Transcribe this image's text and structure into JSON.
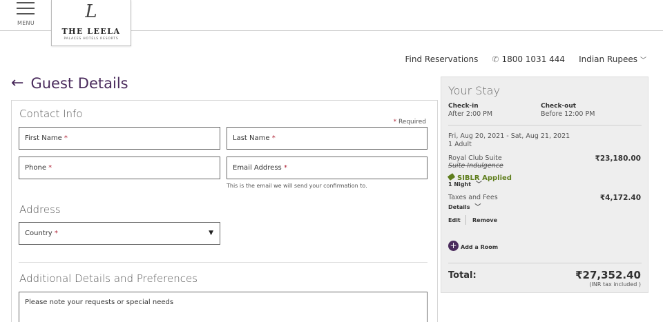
{
  "header": {
    "menu_label": "MENU",
    "logo_glyph": "L",
    "logo_name": "THE LEELA",
    "logo_sub": "PALACES HOTELS RESORTS",
    "find_reservations": "Find Reservations",
    "phone": "1800 1031 444",
    "currency": "Indian Rupees"
  },
  "page": {
    "title": "Guest Details"
  },
  "form": {
    "contact_title": "Contact Info",
    "required_note": "Required",
    "first_name_label": "First Name",
    "last_name_label": "Last Name",
    "phone_label": "Phone",
    "email_label": "Email Address",
    "email_hint": "This is the email we will send your confirmation to.",
    "address_title": "Address",
    "country_label": "Country",
    "additional_title": "Additional Details and Preferences",
    "requests_placeholder": "Please note your requests or special needs"
  },
  "stay": {
    "title": "Your Stay",
    "checkin_label": "Check-in",
    "checkin_value": "After 2:00 PM",
    "checkout_label": "Check-out",
    "checkout_value": "Before 12:00 PM",
    "dates": "Fri, Aug 20, 2021 - Sat, Aug 21, 2021",
    "guests": "1 Adult",
    "room_name": "Royal Club Suite",
    "rate_name": "Suite Indulgence",
    "promo": "SIBLR Applied",
    "nights": "1 Night",
    "room_price": "₹23,180.00",
    "taxes_label": "Taxes and Fees",
    "taxes_details": "Details",
    "taxes_price": "₹4,172.40",
    "edit_label": "Edit",
    "remove_label": "Remove",
    "add_room_label": "Add a Room",
    "total_label": "Total:",
    "total_value": "₹27,352.40",
    "total_note": "(INR tax included )"
  },
  "colors": {
    "brand_purple": "#4a2b5c",
    "required_red": "#b0283a",
    "promo_green": "#5f7e1d"
  }
}
